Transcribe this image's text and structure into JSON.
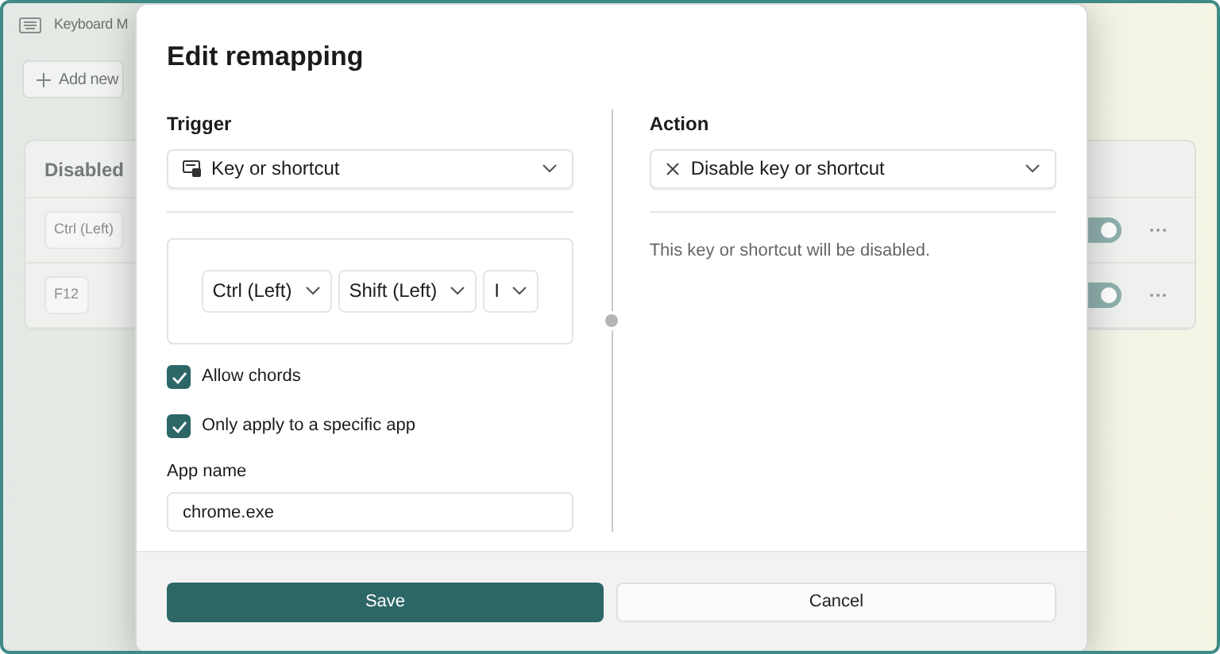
{
  "app": {
    "title": "Keyboard M",
    "add_button": "Add new",
    "list_header": "Disabled",
    "rows": [
      {
        "keys": [
          "Ctrl (Left)"
        ],
        "enabled": true
      },
      {
        "keys": [
          "F12"
        ],
        "enabled": true
      }
    ]
  },
  "dialog": {
    "title": "Edit remapping",
    "trigger": {
      "label": "Trigger",
      "type": "Key or shortcut",
      "keys": [
        "Ctrl (Left)",
        "Shift (Left)",
        "I"
      ],
      "options": [
        {
          "label": "Allow chords",
          "checked": true
        },
        {
          "label": "Only apply to a specific app",
          "checked": true
        }
      ],
      "app_name": {
        "label": "App name",
        "value": "chrome.exe"
      }
    },
    "action": {
      "label": "Action",
      "type": "Disable key or shortcut",
      "description": "This key or shortcut will be disabled."
    },
    "buttons": [
      {
        "label": "Save",
        "kind": "primary"
      },
      {
        "label": "Cancel",
        "kind": "secondary"
      }
    ]
  }
}
